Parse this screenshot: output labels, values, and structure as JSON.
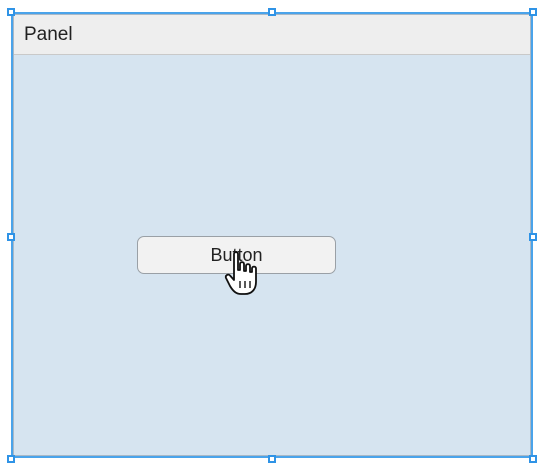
{
  "panel": {
    "title": "Panel",
    "background_color": "#d6e4f0",
    "header_color": "#eeeeee"
  },
  "button": {
    "label": "Button"
  },
  "selection": {
    "color": "#4aa3ea",
    "handle_icon": "resize-handle-icon"
  },
  "cursor": {
    "icon": "hand-pointer-icon"
  }
}
